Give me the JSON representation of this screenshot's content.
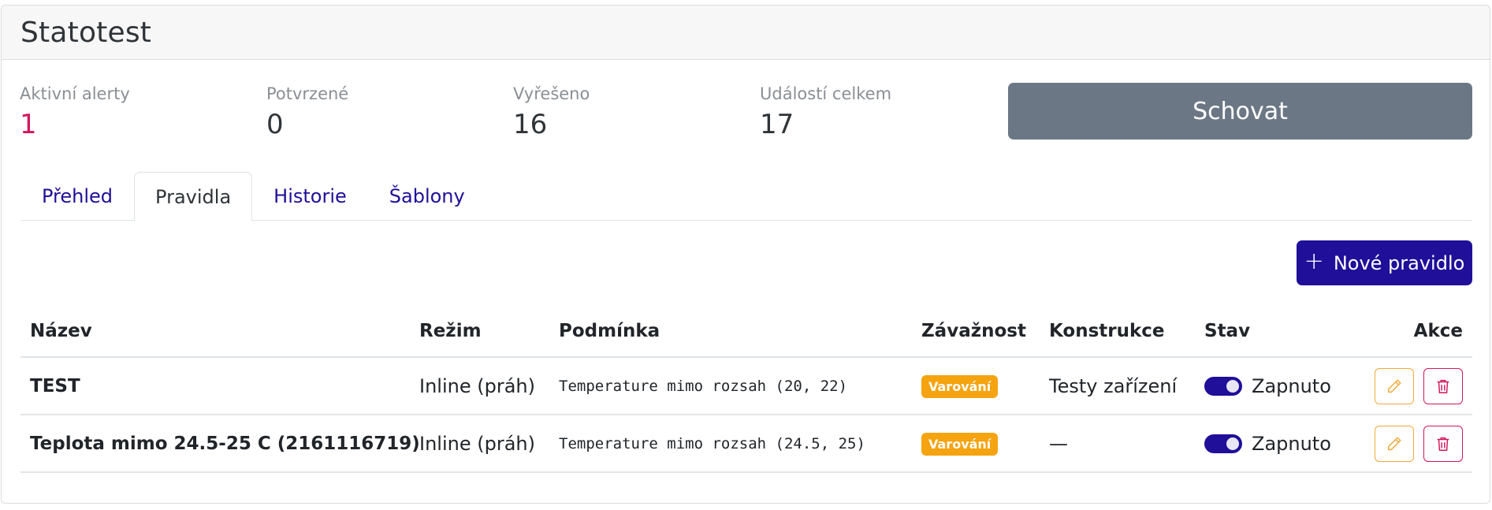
{
  "header": {
    "title": "Statotest"
  },
  "stats": [
    {
      "label": "Aktivní alerty",
      "value": "1"
    },
    {
      "label": "Potvrzené",
      "value": "0"
    },
    {
      "label": "Vyřešeno",
      "value": "16"
    },
    {
      "label": "Událostí celkem",
      "value": "17"
    }
  ],
  "hide_button": "Schovat",
  "tabs": [
    {
      "label": "Přehled"
    },
    {
      "label": "Pravidla",
      "active": true
    },
    {
      "label": "Historie"
    },
    {
      "label": "Šablony"
    }
  ],
  "new_rule_button": {
    "icon": "plus",
    "label": "Nové pravidlo"
  },
  "table": {
    "headers": [
      "Název",
      "Režim",
      "Podmínka",
      "Závažnost",
      "Konstrukce",
      "Stav",
      "Akce"
    ],
    "rows": [
      {
        "name": "TEST",
        "mode": "Inline (práh)",
        "condition": "Temperature mimo rozsah (20, 22)",
        "severity": "Varování",
        "construction": "Testy zařízení",
        "status": "Zapnuto"
      },
      {
        "name": "Teplota mimo 24.5-25 C (2161116719)",
        "mode": "Inline (práh)",
        "condition": "Temperature mimo rozsah (24.5, 25)",
        "severity": "Varování",
        "construction": "—",
        "status": "Zapnuto"
      }
    ]
  },
  "colors": {
    "accent": "#1f0f99",
    "alert": "#d1175a",
    "warning_badge": "#f5a30e",
    "hide_button": "#6c7785",
    "edit_border": "#f2a93b",
    "delete_border": "#d1175a"
  },
  "icons": {
    "edit": "pencil-icon",
    "delete": "trash-icon",
    "add": "plus-icon"
  }
}
